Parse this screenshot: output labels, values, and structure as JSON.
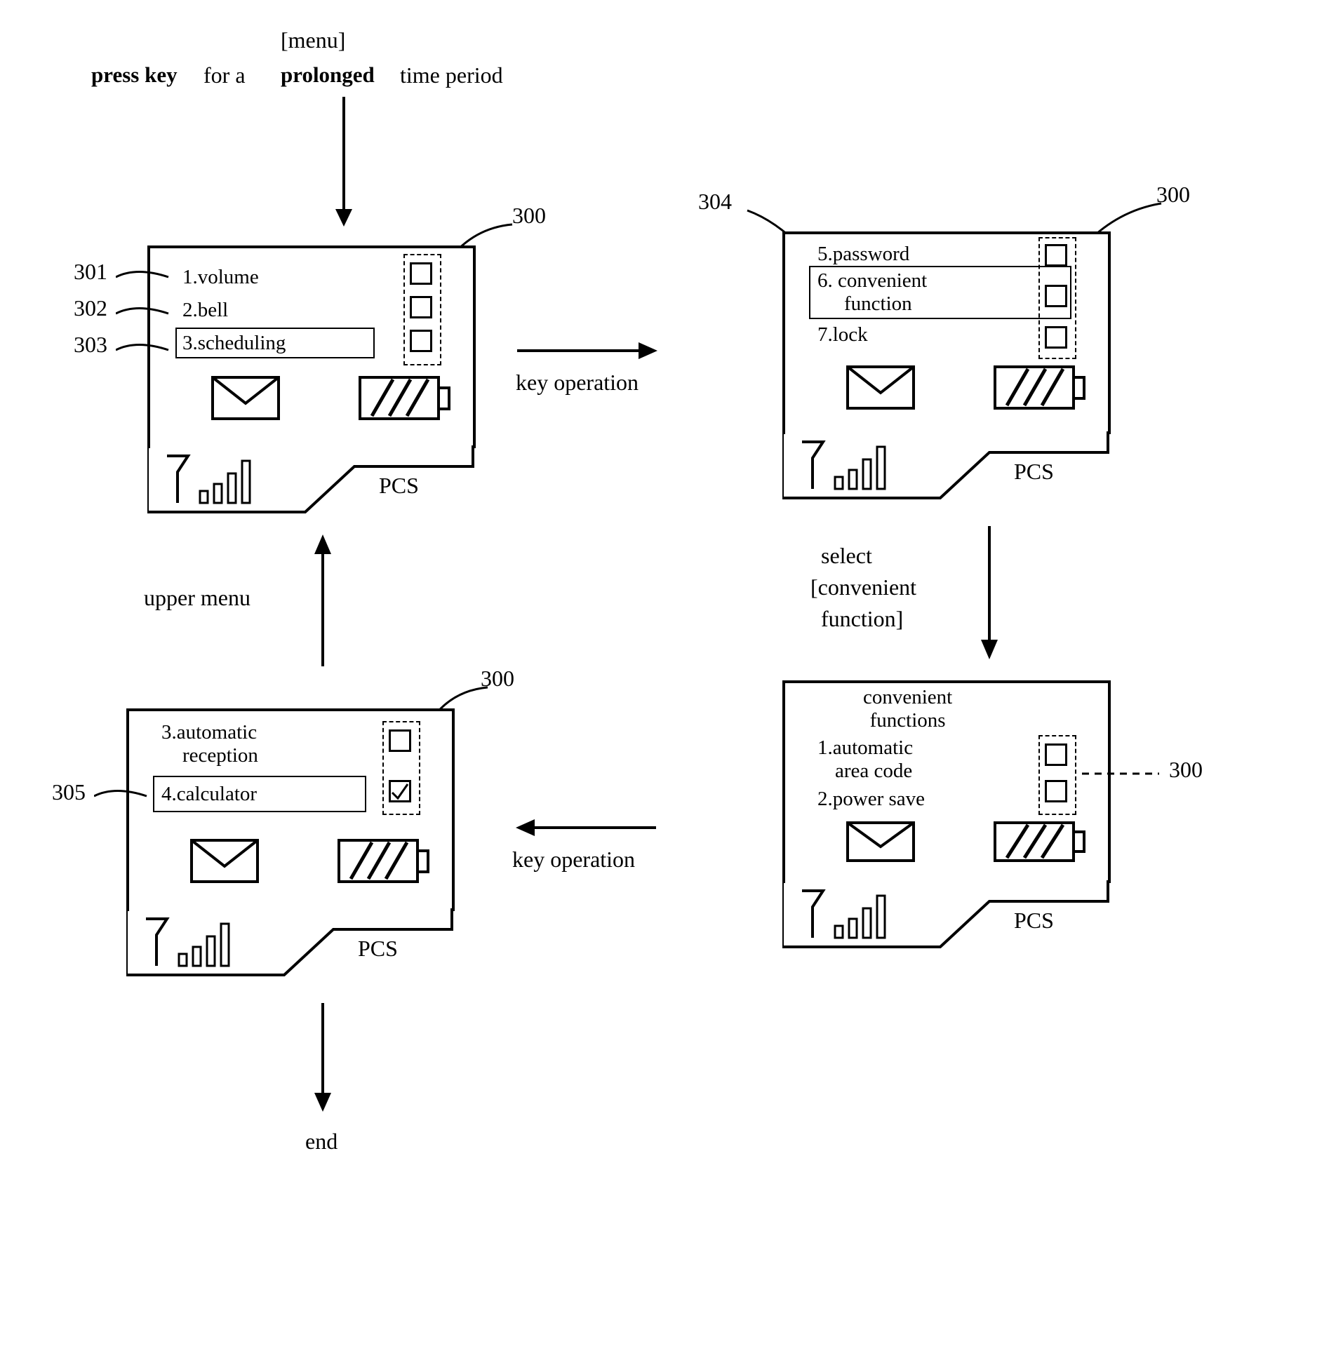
{
  "top_instruction": {
    "press_key": "press key",
    "for_a": "for a",
    "menu_bracket": "[menu]",
    "prolonged": "prolonged",
    "time_period": "time period"
  },
  "device_common": {
    "pcs_label": "PCS"
  },
  "device_tl": {
    "item1": "1.volume",
    "item2": "2.bell",
    "item3": "3.scheduling"
  },
  "device_tr": {
    "item5": "5.password",
    "item6_l1": "6. convenient",
    "item6_l2": "function",
    "item7": "7.lock"
  },
  "device_bl": {
    "item3_l1": "3.automatic",
    "item3_l2": "reception",
    "item4": "4.calculator"
  },
  "device_br": {
    "title_l1": "convenient",
    "title_l2": "functions",
    "item1_l1": "1.automatic",
    "item1_l2": "area code",
    "item2": "2.power save"
  },
  "labels": {
    "r300": "300",
    "r301": "301",
    "r302": "302",
    "r303": "303",
    "r304": "304",
    "r305": "305",
    "key_operation": "key operation",
    "select_l1": "select",
    "select_l2": "[convenient",
    "select_l3": "function]",
    "upper_menu": "upper menu",
    "end": "end"
  }
}
